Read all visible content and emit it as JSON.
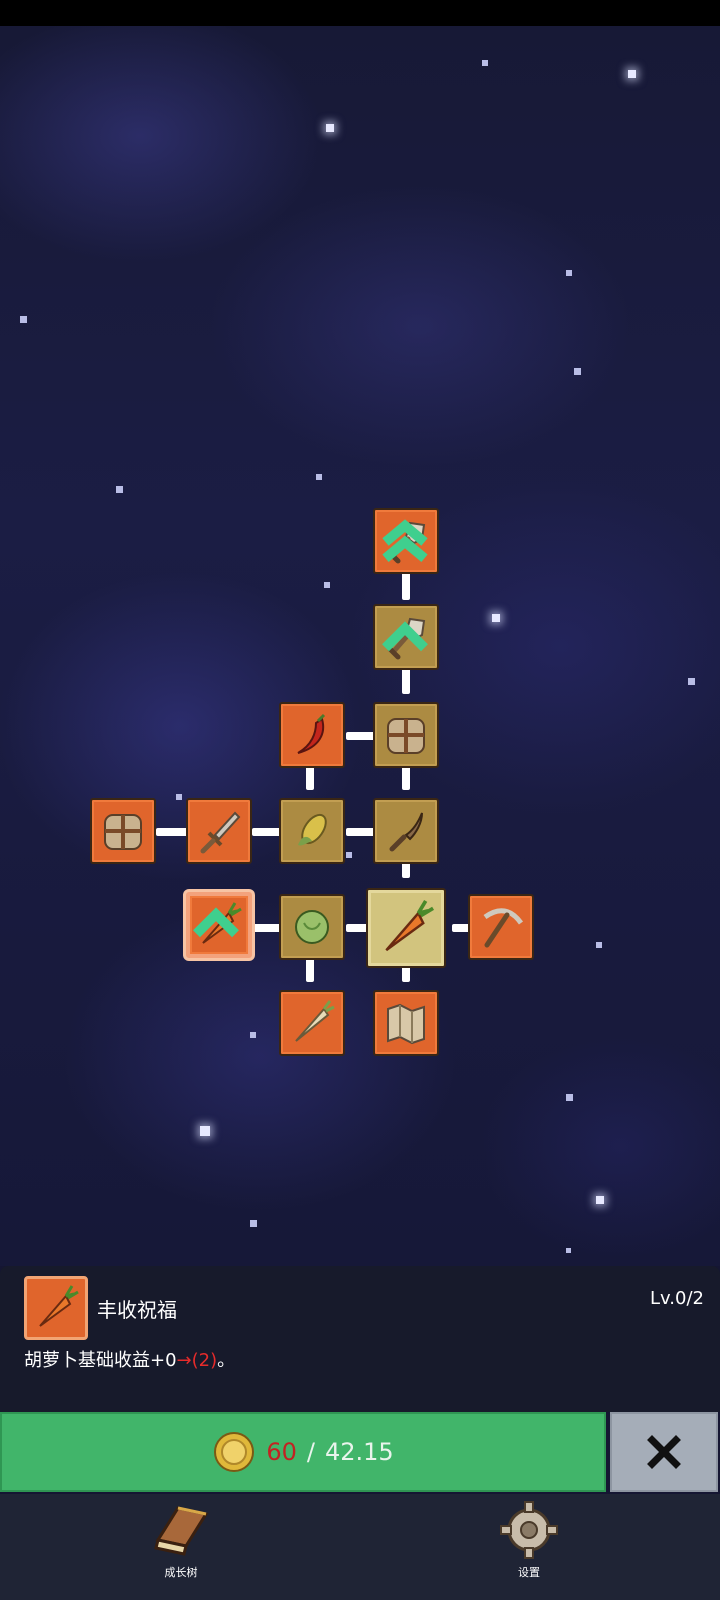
{
  "app": {
    "screen": "skill-tree"
  },
  "skill_tree": {
    "nodes": [
      {
        "id": "shovel-upgrade-top",
        "icon": "shovel-icon",
        "color": "orange",
        "upgradable": true
      },
      {
        "id": "shovel-upgrade",
        "icon": "shovel-icon",
        "color": "gold",
        "upgradable": true
      },
      {
        "id": "chili",
        "icon": "chili-pepper-icon",
        "color": "orange",
        "upgradable": false
      },
      {
        "id": "crate-top",
        "icon": "crate-icon",
        "color": "gold",
        "upgradable": false
      },
      {
        "id": "crate-left",
        "icon": "crate-icon",
        "color": "orange",
        "upgradable": false
      },
      {
        "id": "sword",
        "icon": "sword-icon",
        "color": "orange",
        "upgradable": false
      },
      {
        "id": "corn",
        "icon": "corn-icon",
        "color": "gold",
        "upgradable": false
      },
      {
        "id": "dagger",
        "icon": "dagger-icon",
        "color": "gold",
        "upgradable": false
      },
      {
        "id": "carrot-blessing",
        "icon": "carrot-icon",
        "color": "orange",
        "upgradable": true,
        "selected": true
      },
      {
        "id": "cabbage",
        "icon": "cabbage-icon",
        "color": "gold",
        "upgradable": false
      },
      {
        "id": "carrot-center",
        "icon": "carrot-icon",
        "color": "center",
        "upgradable": false
      },
      {
        "id": "pickaxe",
        "icon": "pickaxe-icon",
        "color": "orange",
        "upgradable": false
      },
      {
        "id": "parsnip",
        "icon": "parsnip-icon",
        "color": "orange",
        "upgradable": false
      },
      {
        "id": "map",
        "icon": "map-icon",
        "color": "orange",
        "upgradable": false
      }
    ]
  },
  "detail": {
    "icon": "carrot-icon",
    "title": "丰收祝福",
    "level": "Lv.0/2",
    "desc_prefix": "胡萝卜基础收益+0",
    "desc_arrow": "→",
    "desc_next": "(2)",
    "desc_suffix": "。"
  },
  "purchase": {
    "coin_icon": "coin-icon",
    "cost": "60",
    "separator": "/",
    "balance": "42.15",
    "close_icon": "close-icon"
  },
  "nav": {
    "items": [
      {
        "label": "成长树",
        "icon": "book-icon"
      },
      {
        "label": "设置",
        "icon": "gear-icon"
      }
    ]
  },
  "colors": {
    "node_orange": "#e0652c",
    "node_gold": "#ac8b42",
    "node_center": "#d2c47e",
    "buy_green": "#41b56a",
    "cost_red": "#c32222",
    "close_gray": "#a5adb8"
  }
}
